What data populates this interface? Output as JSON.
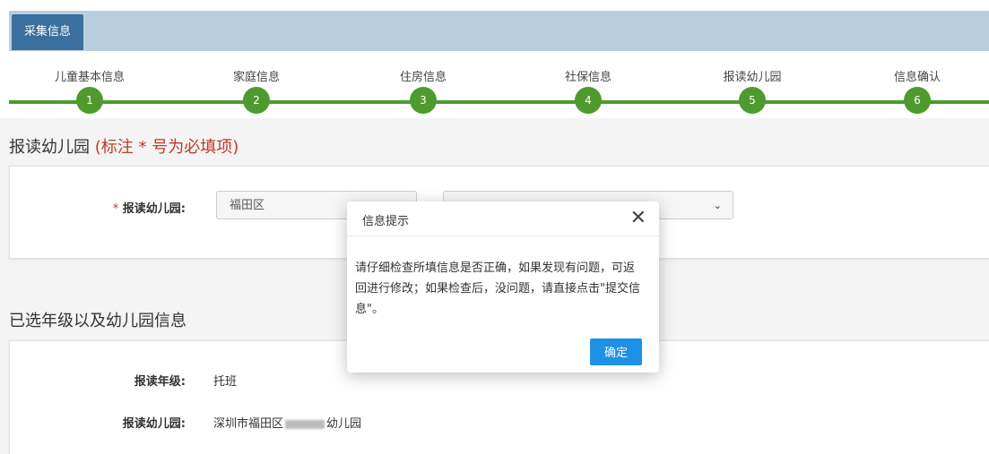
{
  "header": {
    "tab_label": "采集信息"
  },
  "steps": [
    {
      "label": "儿童基本信息",
      "num": "1"
    },
    {
      "label": "家庭信息",
      "num": "2"
    },
    {
      "label": "住房信息",
      "num": "3"
    },
    {
      "label": "社保信息",
      "num": "4"
    },
    {
      "label": "报读幼儿园",
      "num": "5"
    },
    {
      "label": "信息确认",
      "num": "6"
    }
  ],
  "section1": {
    "title": "报读幼儿园",
    "required_note": "(标注 * 号为必填项)"
  },
  "form": {
    "label_star": "*",
    "label": "报读幼儿园:",
    "district_value": "福田区"
  },
  "section2": {
    "title": "已选年级以及幼儿园信息"
  },
  "selected": {
    "grade_label": "报读年级:",
    "grade_value": "托班",
    "kindergarten_label": "报读幼儿园:",
    "kindergarten_prefix": "深圳市福田区",
    "kindergarten_suffix": "幼儿园"
  },
  "modal": {
    "title": "信息提示",
    "close_glyph": "✕",
    "message": "请仔细检查所填信息是否正确，如果发现有问题，可返回进行修改；如果检查后，没问题，请直接点击\"提交信息\"。",
    "ok_label": "确定"
  },
  "colors": {
    "accent": "#4e9a2f",
    "tab": "#3a6f9e",
    "button": "#1e90e6",
    "required": "#c0392b"
  }
}
